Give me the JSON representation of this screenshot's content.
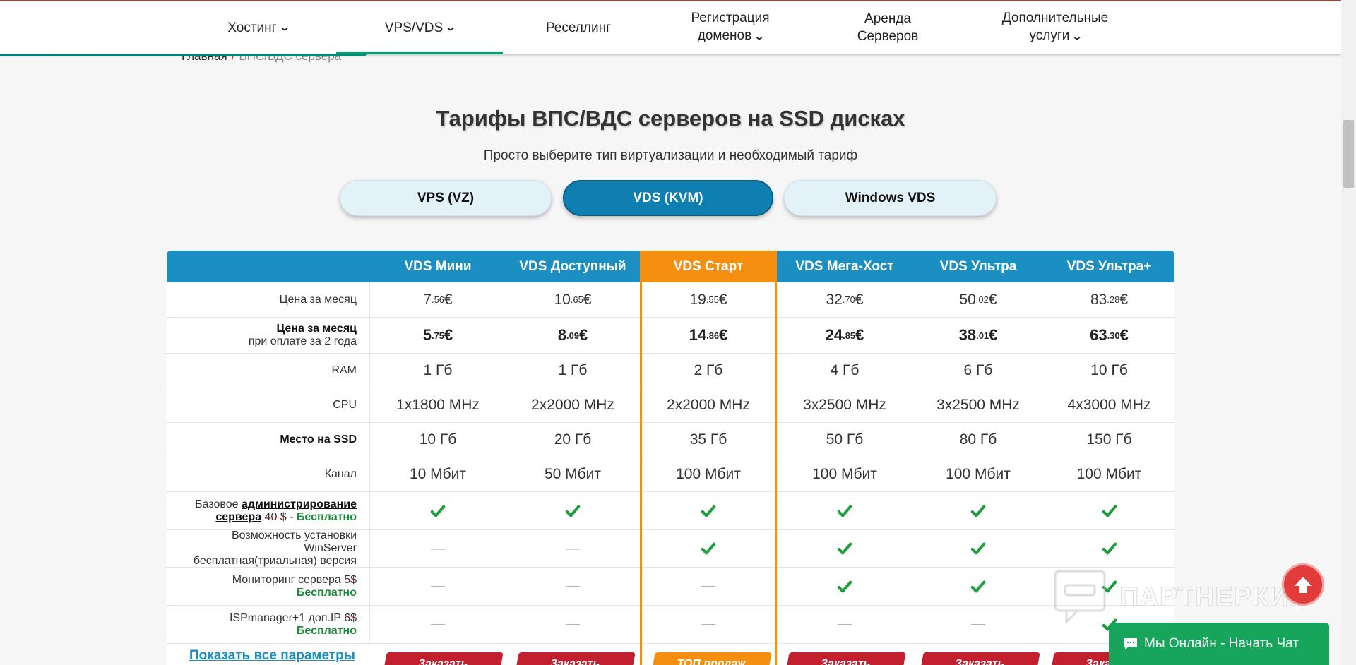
{
  "nav": {
    "items": [
      {
        "label": "Хостинг",
        "has_dropdown": true
      },
      {
        "label": "VPS/VDS",
        "has_dropdown": true,
        "active": true
      },
      {
        "label": "Реселлинг",
        "has_dropdown": false
      },
      {
        "label_line1": "Регистрация",
        "label_line2": "доменов",
        "has_dropdown": true
      },
      {
        "label_line1": "Аренда",
        "label_line2": "Серверов",
        "has_dropdown": false
      },
      {
        "label_line1": "Дополнительные",
        "label_line2": "услуги",
        "has_dropdown": true
      }
    ]
  },
  "breadcrumb": {
    "home": "Главная",
    "separator": "/",
    "current": "ВПС/ВДС сервера"
  },
  "page": {
    "title": "Тарифы ВПС/ВДС серверов на SSD дисках",
    "subtitle": "Просто выберите тип виртуализации и необходимый тариф"
  },
  "tabs": [
    {
      "label": "VPS (VZ)",
      "active": false
    },
    {
      "label": "VDS (KVM)",
      "active": true
    },
    {
      "label": "Windows VDS",
      "active": false
    }
  ],
  "plans": [
    {
      "name": "VDS Мини",
      "featured": false
    },
    {
      "name": "VDS Доступный",
      "featured": false
    },
    {
      "name": "VDS Старт",
      "featured": true
    },
    {
      "name": "VDS Мега-Хост",
      "featured": false
    },
    {
      "name": "VDS Ультра",
      "featured": false
    },
    {
      "name": "VDS Ультра+",
      "featured": false
    }
  ],
  "rows": {
    "price_month": {
      "label": "Цена за месяц",
      "values": [
        {
          "int": "7",
          "frac": ".56",
          "cur": "€"
        },
        {
          "int": "10",
          "frac": ".65",
          "cur": "€"
        },
        {
          "int": "19",
          "frac": ".55",
          "cur": "€"
        },
        {
          "int": "32",
          "frac": ".70",
          "cur": "€"
        },
        {
          "int": "50",
          "frac": ".02",
          "cur": "€"
        },
        {
          "int": "83",
          "frac": ".28",
          "cur": "€"
        }
      ]
    },
    "price_2y": {
      "label_line1": "Цена за месяц",
      "label_line2": "при оплате за 2 года",
      "values": [
        {
          "int": "5",
          "frac": ".75",
          "cur": "€"
        },
        {
          "int": "8",
          "frac": ".09",
          "cur": "€"
        },
        {
          "int": "14",
          "frac": ".86",
          "cur": "€"
        },
        {
          "int": "24",
          "frac": ".85",
          "cur": "€"
        },
        {
          "int": "38",
          "frac": ".01",
          "cur": "€"
        },
        {
          "int": "63",
          "frac": ".30",
          "cur": "€"
        }
      ]
    },
    "ram": {
      "label": "RAM",
      "values": [
        "1 Гб",
        "1 Гб",
        "2 Гб",
        "4 Гб",
        "6 Гб",
        "10 Гб"
      ]
    },
    "cpu": {
      "label": "CPU",
      "values": [
        "1x1800 MHz",
        "2x2000 MHz",
        "2x2000 MHz",
        "3x2500 MHz",
        "3x2500 MHz",
        "4x3000 MHz"
      ]
    },
    "ssd": {
      "label": "Место на SSD",
      "values": [
        "10 Гб",
        "20 Гб",
        "35 Гб",
        "50 Гб",
        "80 Гб",
        "150 Гб"
      ]
    },
    "channel": {
      "label": "Канал",
      "values": [
        "10 Мбит",
        "50 Мбит",
        "100 Мбит",
        "100 Мбит",
        "100 Мбит",
        "100 Мбит"
      ]
    },
    "admin": {
      "label_prefix": "Базовое ",
      "label_link1": "администрирование",
      "label_link2": "сервера",
      "old_price": "40 $",
      "dash": " - ",
      "free": "Бесплатно",
      "included": [
        true,
        true,
        true,
        true,
        true,
        true
      ]
    },
    "winserver": {
      "label_line1": "Возможность установки",
      "label_line2": "WinServer",
      "label_line3": "бесплатная(триальная) версия",
      "included": [
        false,
        false,
        true,
        true,
        true,
        true
      ]
    },
    "monitoring": {
      "label": "Мониторинг сервера ",
      "old_price": "5$",
      "free": "Бесплатно",
      "included": [
        false,
        false,
        false,
        true,
        true,
        true
      ]
    },
    "ispmanager": {
      "label": "ISPmanager+1 доп.IP ",
      "old_price": "6$",
      "free": "Бесплатно",
      "included": [
        false,
        false,
        false,
        false,
        false,
        true
      ]
    }
  },
  "footer_row": {
    "show_all": "Показать все параметры",
    "order_label": "Заказать",
    "top_label": "ТОП продаж"
  },
  "dash_symbol": "—",
  "watermark": "ПАРТНЕРКИН",
  "chat": {
    "label": "Мы Онлайн - Начать Чат"
  },
  "colors": {
    "header_blue": "#1b8fc1",
    "featured_orange": "#f68e0f",
    "active_tab": "#0e7fb0",
    "check_green": "#1e9e3c",
    "order_red": "#c21f2f",
    "chat_green": "#16a55a",
    "nav_active_underline": "#0f9a6a"
  },
  "icons": {
    "check": "check-icon",
    "chevron": "chevron-down-icon",
    "up": "arrow-up-icon",
    "chat": "chat-bubble-icon"
  }
}
